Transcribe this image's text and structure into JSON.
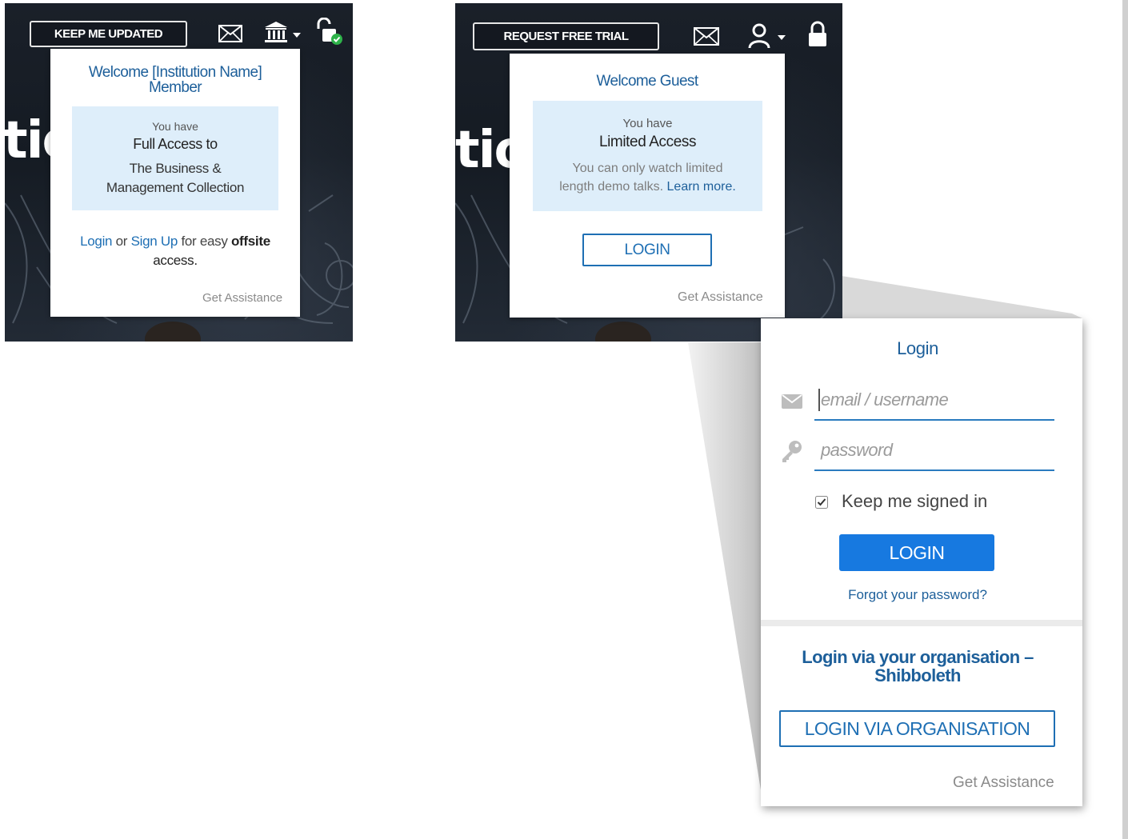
{
  "left_widget": {
    "hero_text": "tio",
    "top_button": "KEEP ME UPDATED",
    "dropdown": {
      "title_line1": "Welcome [Institution Name]",
      "title_line2": "Member",
      "info_line1": "You have",
      "info_line2": "Full Access to",
      "info_line3": "The Business &",
      "info_line4": "Management Collection",
      "login_link": "Login",
      "or_text": "or",
      "signup_link": "Sign Up",
      "for_easy": "for easy",
      "offsite": "offsite",
      "access": "access.",
      "get_assistance": "Get Assistance"
    }
  },
  "right_widget": {
    "hero_text": "tio",
    "top_button": "REQUEST FREE TRIAL",
    "dropdown": {
      "title": "Welcome Guest",
      "info_line1": "You have",
      "info_line2": "Limited Access",
      "info_line3": "You can only watch limited",
      "info_line4": "length demo talks.",
      "learn_more": "Learn more.",
      "login_button": "LOGIN",
      "get_assistance": "Get Assistance"
    }
  },
  "login_panel": {
    "title": "Login",
    "email_placeholder": "email / username",
    "password_placeholder": "password",
    "keep_signed_in": "Keep me signed in",
    "keep_signed_in_checked": true,
    "login_button": "LOGIN",
    "forgot_password": "Forgot your password?",
    "org_title_line1": "Login via your organisation –",
    "org_title_line2": "Shibboleth",
    "org_button": "LOGIN VIA ORGANISATION",
    "get_assistance": "Get Assistance"
  },
  "icons": {
    "envelope": "envelope-icon",
    "institution": "institution-icon",
    "unlock": "unlocked-padlock-icon",
    "user": "user-icon",
    "lock": "padlock-icon",
    "key": "key-icon",
    "check": "check-badge-icon"
  },
  "colors": {
    "accent_blue": "#1d5f9a",
    "link_blue": "#1e6fb4",
    "primary_button": "#1779e0",
    "info_box": "#deeefa",
    "green_badge": "#2eb34a"
  }
}
